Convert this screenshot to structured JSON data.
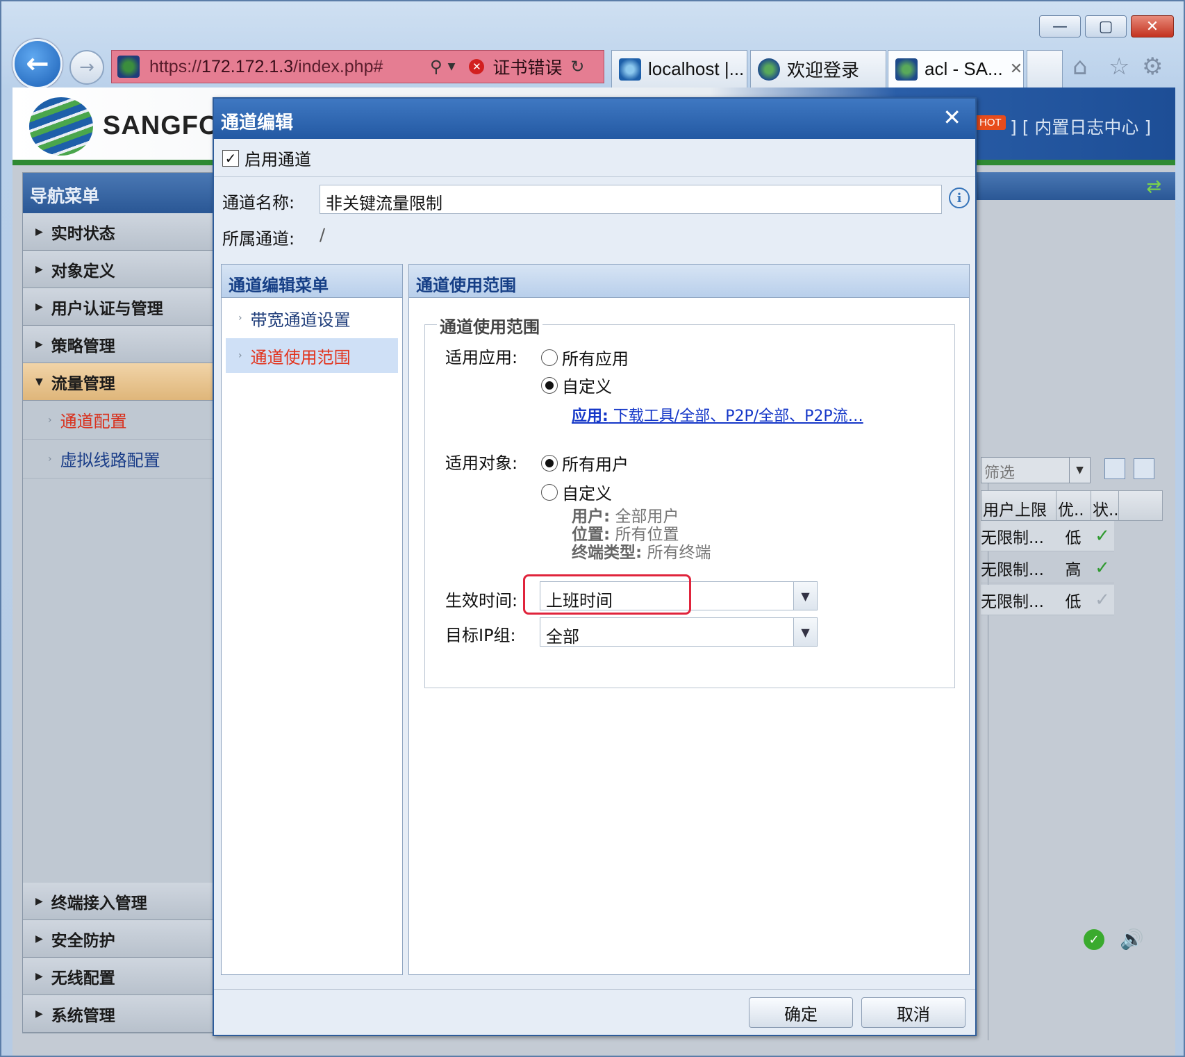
{
  "browser": {
    "url_prefix": "https://",
    "url_host": "172.172.1.3",
    "url_path": "/index.php#",
    "cert_error": "证书错误",
    "tabs": [
      {
        "label": "localhost |..."
      },
      {
        "label": "欢迎登录"
      },
      {
        "label": "acl - SA..."
      }
    ],
    "window_buttons": {
      "min": "—",
      "max": "▢",
      "close": "✕"
    }
  },
  "header": {
    "brand": "SANGFOR",
    "hot": "HOT",
    "log_link": "] [ 内置日志中心 ]"
  },
  "nav": {
    "title": "导航菜单",
    "items": [
      {
        "label": "实时状态"
      },
      {
        "label": "对象定义"
      },
      {
        "label": "用户认证与管理"
      },
      {
        "label": "策略管理"
      },
      {
        "label": "流量管理",
        "expanded": true
      }
    ],
    "subitems": [
      {
        "label": "通道配置",
        "selected": true
      },
      {
        "label": "虚拟线路配置"
      }
    ],
    "bottom_items": [
      {
        "label": "终端接入管理"
      },
      {
        "label": "安全防护"
      },
      {
        "label": "无线配置"
      },
      {
        "label": "系统管理"
      }
    ]
  },
  "background_grid": {
    "filter_placeholder": "筛选",
    "headers": [
      "用户上限",
      "优..",
      "状.."
    ],
    "rows": [
      {
        "limit": "无限制...",
        "priority": "低",
        "status": "✓"
      },
      {
        "limit": "无限制...",
        "priority": "高",
        "status": "✓"
      },
      {
        "limit": "无限制...",
        "priority": "低",
        "status": "✓"
      }
    ]
  },
  "dialog": {
    "title": "通道编辑",
    "enable_label": "启用通道",
    "enable_checked": true,
    "name_label": "通道名称:",
    "name_value": "非关键流量限制",
    "parent_label": "所属通道:",
    "parent_value": "/",
    "menu": {
      "title": "通道编辑菜单",
      "items": [
        {
          "label": "带宽通道设置"
        },
        {
          "label": "通道使用范围",
          "selected": true
        }
      ]
    },
    "scope": {
      "panel_title": "通道使用范围",
      "legend": "通道使用范围",
      "apply_label": "适用应用:",
      "apply_options": [
        "所有应用",
        "自定义"
      ],
      "apply_selected": "自定义",
      "app_link_prefix": "应用:",
      "app_link_value": " 下载工具/全部、P2P/全部、P2P流…",
      "object_label": "适用对象:",
      "object_options": [
        "所有用户",
        "自定义"
      ],
      "object_selected": "所有用户",
      "detail_user_key": "用户:",
      "detail_user_val": " 全部用户",
      "detail_loc_key": "位置:",
      "detail_loc_val": " 所有位置",
      "detail_term_key": "终端类型:",
      "detail_term_val": " 所有终端",
      "time_label": "生效时间:",
      "time_value": "上班时间",
      "ip_label": "目标IP组:",
      "ip_value": "全部"
    },
    "ok_label": "确定",
    "cancel_label": "取消"
  },
  "colors": {
    "highlight": "#e0243c",
    "nav_active": "#dfb67a",
    "selected_text": "#e2341e",
    "dialog_title": "#2359a3"
  }
}
